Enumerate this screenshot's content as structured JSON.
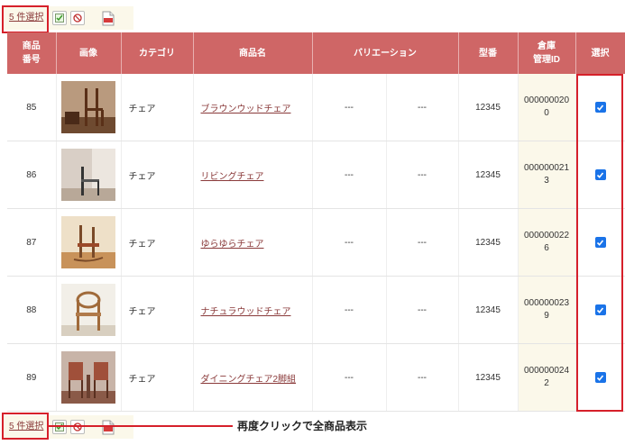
{
  "toolbar": {
    "selected_label": "5 件選択"
  },
  "table": {
    "headers": {
      "no": "商品\n番号",
      "image": "画像",
      "category": "カテゴリ",
      "name": "商品名",
      "variation": "バリエーション",
      "model": "型番",
      "warehouse": "倉庫\n管理ID",
      "select": "選択"
    },
    "rows": [
      {
        "no": "85",
        "category": "チェア",
        "name": "ブラウンウッドチェア",
        "var1": "---",
        "var2": "---",
        "model": "12345",
        "wh1": "000000020",
        "wh2": "0"
      },
      {
        "no": "86",
        "category": "チェア",
        "name": "リビングチェア",
        "var1": "---",
        "var2": "---",
        "model": "12345",
        "wh1": "000000021",
        "wh2": "3"
      },
      {
        "no": "87",
        "category": "チェア",
        "name": "ゆらゆらチェア",
        "var1": "---",
        "var2": "---",
        "model": "12345",
        "wh1": "000000022",
        "wh2": "6"
      },
      {
        "no": "88",
        "category": "チェア",
        "name": "ナチュラウッドチェア",
        "var1": "---",
        "var2": "---",
        "model": "12345",
        "wh1": "000000023",
        "wh2": "9"
      },
      {
        "no": "89",
        "category": "チェア",
        "name": "ダイニングチェア2脚組",
        "var1": "---",
        "var2": "---",
        "model": "12345",
        "wh1": "000000024",
        "wh2": "2"
      }
    ]
  },
  "callout": {
    "text": "再度クリックで全商品表示"
  },
  "colors": {
    "header_bg": "#cf6666",
    "highlight": "#d6202a",
    "checkbox": "#1a73e8",
    "link": "#8a3a3a",
    "cream": "#fbf8ea"
  }
}
